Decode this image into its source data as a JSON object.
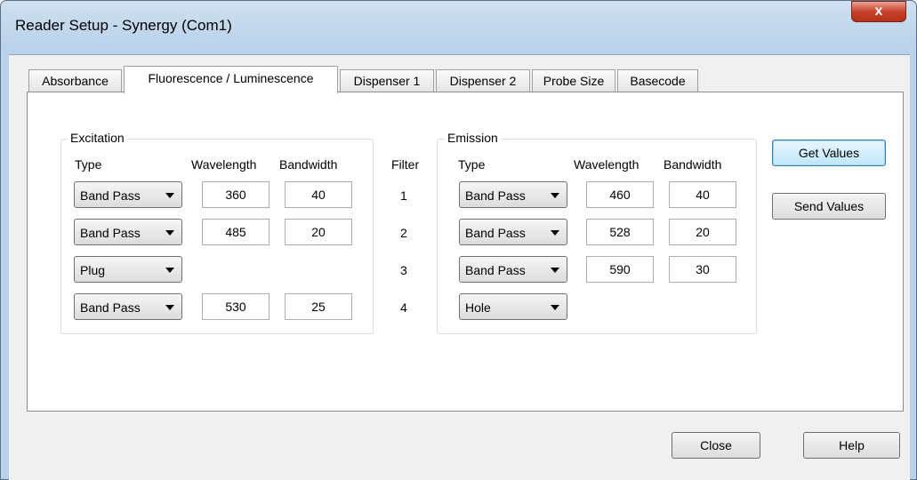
{
  "window": {
    "title": "Reader Setup - Synergy (Com1)",
    "close_glyph": "x"
  },
  "tabs": [
    {
      "label": "Absorbance"
    },
    {
      "label": "Fluorescence / Luminescence",
      "active": true
    },
    {
      "label": "Dispenser 1"
    },
    {
      "label": "Dispenser 2"
    },
    {
      "label": "Probe Size"
    },
    {
      "label": "Basecode"
    }
  ],
  "excitation": {
    "legend": "Excitation",
    "headers": {
      "type": "Type",
      "wavelength": "Wavelength",
      "bandwidth": "Bandwidth"
    },
    "rows": [
      {
        "type": "Band Pass",
        "wavelength": "360",
        "bandwidth": "40"
      },
      {
        "type": "Band Pass",
        "wavelength": "485",
        "bandwidth": "20"
      },
      {
        "type": "Plug",
        "wavelength": "",
        "bandwidth": ""
      },
      {
        "type": "Band Pass",
        "wavelength": "530",
        "bandwidth": "25"
      }
    ]
  },
  "filter": {
    "header": "Filter",
    "numbers": [
      "1",
      "2",
      "3",
      "4"
    ]
  },
  "emission": {
    "legend": "Emission",
    "headers": {
      "type": "Type",
      "wavelength": "Wavelength",
      "bandwidth": "Bandwidth"
    },
    "rows": [
      {
        "type": "Band Pass",
        "wavelength": "460",
        "bandwidth": "40"
      },
      {
        "type": "Band Pass",
        "wavelength": "528",
        "bandwidth": "20"
      },
      {
        "type": "Band Pass",
        "wavelength": "590",
        "bandwidth": "30"
      },
      {
        "type": "Hole",
        "wavelength": "",
        "bandwidth": ""
      }
    ]
  },
  "buttons": {
    "get_values": "Get Values",
    "send_values": "Send Values",
    "close": "Close",
    "help": "Help"
  },
  "icons": {
    "dropdown": "chevron-down-icon",
    "close": "close-icon"
  }
}
